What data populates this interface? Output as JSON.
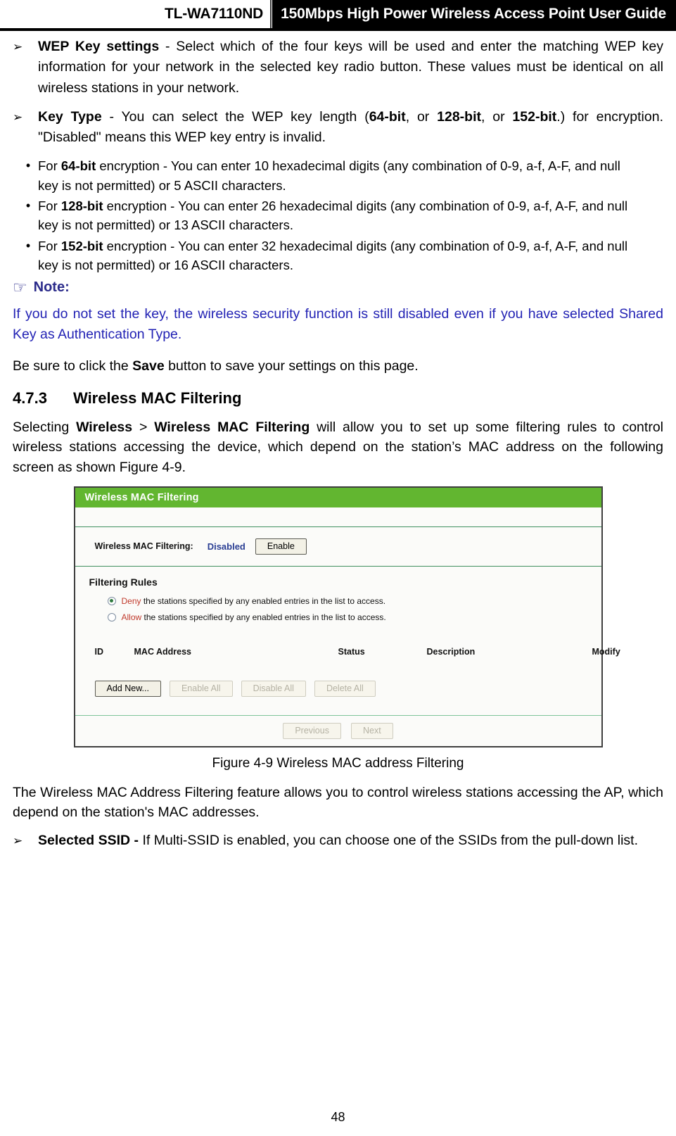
{
  "header": {
    "model": "TL-WA7110ND",
    "title": "150Mbps High Power Wireless Access Point User Guide"
  },
  "bullets_top": [
    {
      "marker": "➢",
      "term": "WEP Key settings",
      "rest": " - Select which of the four keys will be used and enter the matching WEP key information for your network in the selected key radio button. These values must  be identical on all wireless stations in your network."
    },
    {
      "marker": "➢",
      "term": "Key Type",
      "rest_a": " - You can select the WEP key length (",
      "b1": "64-bit",
      "sep1": ", or ",
      "b2": "128-bit",
      "sep2": ", or ",
      "b3": "152-bit",
      "rest_b": ".) for encryption. \"Disabled\" means this WEP key entry is invalid."
    }
  ],
  "sublist": {
    "marker": "•",
    "items": [
      {
        "pre": "For ",
        "bold": "64-bit",
        "post": " encryption - You can enter 10 hexadecimal digits (any combination of 0-9, a-f, A-F, and null key is not permitted) or 5 ASCII characters."
      },
      {
        "pre": "For ",
        "bold": "128-bit",
        "post": " encryption - You can enter 26 hexadecimal digits (any combination of 0-9, a-f, A-F, and null key is not permitted) or 13 ASCII characters."
      },
      {
        "pre": "For ",
        "bold": "152-bit",
        "post": " encryption - You can enter 32 hexadecimal digits (any combination of 0-9, a-f, A-F, and null key is not permitted) or 16 ASCII characters."
      }
    ]
  },
  "note": {
    "hand_icon": "☞",
    "label": "Note:",
    "body": "If you do not set the key, the wireless security function is still disabled even if you have selected Shared Key as Authentication Type.",
    "color": "#2222b4"
  },
  "save_para": {
    "pre": "Be sure to click the ",
    "bold": "Save",
    "post": " button to save your settings on this page."
  },
  "section": {
    "number": "4.7.3",
    "title": "Wireless MAC Filtering"
  },
  "intro_para": {
    "p1": "Selecting  ",
    "b1": "Wireless",
    "p2": " > ",
    "b2": "Wireless MAC Filtering",
    "p3": " will allow you to set up some filtering  rules  to control wireless stations accessing the device, which depend on the station’s MAC address on the following screen as shown Figure 4-9."
  },
  "figure": {
    "titlebar": "Wireless MAC Filtering",
    "toggle_label": "Wireless MAC Filtering:",
    "toggle_value": "Disabled",
    "toggle_button": "Enable",
    "rules_heading": "Filtering Rules",
    "rules": [
      {
        "selected": true,
        "keyword": "Deny",
        "text": " the stations specified by any enabled entries in the list to access."
      },
      {
        "selected": false,
        "keyword": "Allow",
        "text": " the stations specified by any enabled entries in the list to access."
      }
    ],
    "table_headers": [
      "ID",
      "MAC Address",
      "Status",
      "Description",
      "Modify"
    ],
    "table_rows": [],
    "action_buttons": [
      {
        "label": "Add New...",
        "disabled": false
      },
      {
        "label": "Enable All",
        "disabled": true
      },
      {
        "label": "Disable All",
        "disabled": true
      },
      {
        "label": "Delete All",
        "disabled": true
      }
    ],
    "pager_buttons": [
      {
        "label": "Previous",
        "disabled": true
      },
      {
        "label": "Next",
        "disabled": true
      }
    ],
    "accent_green": "#62b630"
  },
  "figure_caption": "Figure 4-9 Wireless MAC address Filtering",
  "after_figure_para": "The Wireless MAC Address Filtering feature allows you to control wireless stations accessing the AP, which depend on the station's MAC addresses.",
  "bullet_ssid": {
    "marker": "➢",
    "term": "Selected SSID -",
    "rest": " If Multi-SSID is enabled, you can choose one of the SSIDs from   the pull-down list."
  },
  "page_number": "48"
}
